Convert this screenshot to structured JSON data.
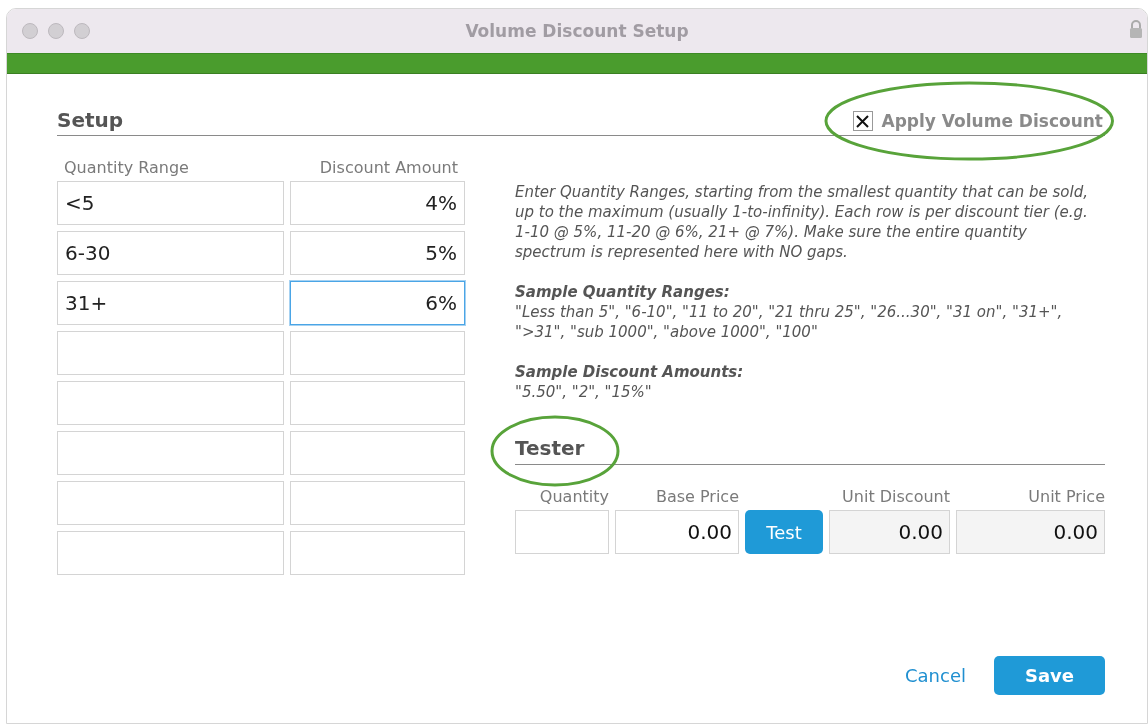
{
  "window": {
    "title": "Volume Discount Setup"
  },
  "setup": {
    "heading": "Setup",
    "apply_discount": {
      "label": "Apply Volume Discount",
      "checked": true,
      "circled": true
    },
    "columns": [
      "Quantity Range",
      "Discount Amount"
    ],
    "rows": [
      {
        "range": "<5",
        "amount": "4%",
        "focused": false
      },
      {
        "range": "6-30",
        "amount": "5%",
        "focused": false
      },
      {
        "range": "31+",
        "amount": "6%",
        "focused": true
      },
      {
        "focused": false
      },
      {
        "focused": false
      },
      {
        "focused": false
      },
      {
        "focused": false
      },
      {
        "focused": false
      }
    ]
  },
  "instructions": {
    "text": "Enter Quantity Ranges, starting from the smallest quantity that can be sold, up to the maximum (usually 1-to-infinity). Each row is per discount tier (e.g. 1-10 @ 5%, 11-20 @ 6%, 21+ @ 7%). Make sure the entire quantity spectrum is represented here with NO gaps.",
    "sections": [
      {
        "title": "Sample Quantity Ranges:",
        "text": "\"Less than 5\", \"6-10\", \"11 to 20\", \"21 thru 25\", \"26...30\", \"31 on\", \"31+\", \">31\", \"sub 1000\", \"above 1000\", \"100\""
      },
      {
        "title": "Sample Discount Amounts:",
        "text": "\"5.50\", \"2\", \"15%\""
      }
    ]
  },
  "tester": {
    "heading": "Tester",
    "circled": true,
    "fields": [
      {
        "kind": "input",
        "label": "Quantity"
      },
      {
        "kind": "input",
        "label": "Base Price",
        "value": "0.00"
      },
      {
        "kind": "button",
        "label": "Test"
      },
      {
        "kind": "readonly",
        "label": "Unit Discount",
        "value": "0.00"
      },
      {
        "kind": "readonly",
        "label": "Unit Price",
        "value": "0.00"
      }
    ]
  },
  "buttons": [
    {
      "kind": "link",
      "label": "Cancel"
    },
    {
      "kind": "primary",
      "label": "Save"
    }
  ]
}
